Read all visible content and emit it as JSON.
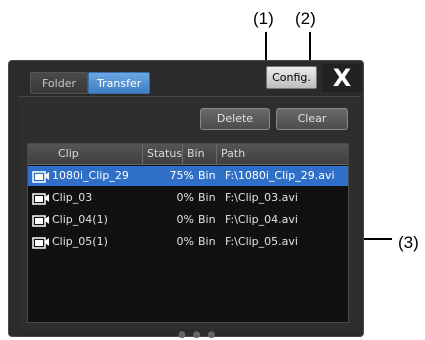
{
  "callouts": {
    "label_1": "(1)",
    "label_2": "(2)",
    "label_3": "(3)"
  },
  "tabs": [
    {
      "label": "Folder",
      "active": false
    },
    {
      "label": "Transfer",
      "active": true
    }
  ],
  "header": {
    "config_label": "Config.",
    "close_label": "X"
  },
  "actions": {
    "delete_label": "Delete",
    "clear_label": "Clear"
  },
  "list": {
    "columns": [
      "Clip",
      "Status",
      "Bin",
      "Path"
    ],
    "rows": [
      {
        "clip": "1080i_Clip_29",
        "status": "75%",
        "bin": "Bin",
        "path": "F:\\1080i_Clip_29.avi",
        "selected": true
      },
      {
        "clip": "Clip_03",
        "status": "0%",
        "bin": "Bin",
        "path": "F:\\Clip_03.avi",
        "selected": false
      },
      {
        "clip": "Clip_04(1)",
        "status": "0%",
        "bin": "Bin",
        "path": "F:\\Clip_04.avi",
        "selected": false
      },
      {
        "clip": "Clip_05(1)",
        "status": "0%",
        "bin": "Bin",
        "path": "F:\\Clip_05.avi",
        "selected": false
      }
    ]
  },
  "colors": {
    "selected_row": "#2f6fc7",
    "panel_bg": "#2b2b2b",
    "list_bg": "#111111"
  },
  "icons": {
    "clip_row": "clip-icon",
    "close": "close-icon"
  }
}
